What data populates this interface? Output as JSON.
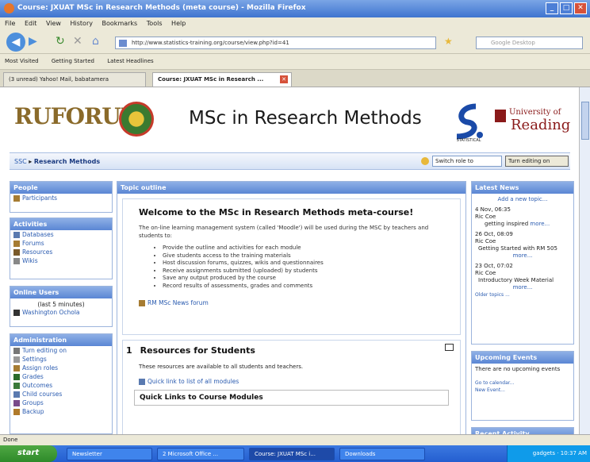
{
  "window": {
    "title": "Course: JXUAT MSc in Research Methods (meta course) - Mozilla Firefox"
  },
  "menu": [
    "File",
    "Edit",
    "View",
    "History",
    "Bookmarks",
    "Tools",
    "Help"
  ],
  "nav": {
    "url": "http://www.statistics-training.org/course/view.php?id=41",
    "search_placeholder": "Google Desktop"
  },
  "bookmarks": [
    "Most Visited",
    "Getting Started",
    "Latest Headlines"
  ],
  "tabs": [
    {
      "label": "(3 unread) Yahoo! Mail, babatamera"
    },
    {
      "label": "Course: JXUAT MSc in Research ..."
    }
  ],
  "header": {
    "ruforum": "RUFORUM",
    "title": "MSc in Research Methods",
    "university_line1": "University of",
    "university_line2": "Reading",
    "statistical": "STATISTICAL"
  },
  "breadcrumb": {
    "root": "SSC",
    "current": "Research Methods",
    "switch_label": "Switch role to",
    "edit_button": "Turn editing on"
  },
  "left": {
    "people": {
      "title": "People",
      "items": [
        "Participants"
      ]
    },
    "activities": {
      "title": "Activities",
      "items": [
        "Databases",
        "Forums",
        "Resources",
        "Wikis"
      ]
    },
    "online": {
      "title": "Online Users",
      "note": "(last 5 minutes)",
      "user": "Washington Ochola"
    },
    "admin": {
      "title": "Administration",
      "items": [
        "Turn editing on",
        "Settings",
        "Assign roles",
        "Grades",
        "Outcomes",
        "Child courses",
        "Groups",
        "Backup"
      ]
    }
  },
  "main": {
    "title": "Topic outline",
    "welcome": {
      "heading": "Welcome to the MSc in Research Methods meta-course!",
      "intro": "The on-line learning management system (called 'Moodle') will be used during the MSC by teachers and students to:",
      "bullets": [
        "Provide the outline and activities for each module",
        "Give students access to the training materials",
        "Host discussion forums, quizzes, wikis and questionnaires",
        "Receive assignments submitted (uploaded) by students",
        "Save any output produced by the course",
        "Record results of assessments, grades and comments"
      ],
      "forum": "RM MSc News forum"
    },
    "section1": {
      "number": "1",
      "heading": "Resources for Students",
      "text": "These resources are available to all students and teachers.",
      "link": "Quick link to list of all modules",
      "sub": "Quick Links to Course Modules"
    }
  },
  "right": {
    "news": {
      "title": "Latest News",
      "add": "Add a new topic...",
      "items": [
        {
          "date": "4 Nov, 06:35",
          "author": "Ric Coe",
          "text": "getting inspired",
          "more": "more..."
        },
        {
          "date": "26 Oct, 08:09",
          "author": "Ric Coe",
          "text": "Getting Started with RM 505",
          "more": "more..."
        },
        {
          "date": "23 Oct, 07:02",
          "author": "Ric Coe",
          "text": "Introductory Week Material",
          "more": "more..."
        }
      ],
      "older": "Older topics ..."
    },
    "events": {
      "title": "Upcoming Events",
      "text": "There are no upcoming events",
      "calendar": "Go to calendar...",
      "new_event": "New Event..."
    },
    "activity": {
      "title": "Recent Activity"
    }
  },
  "status": "Done",
  "taskbar": {
    "start": "start",
    "items": [
      "Newsletter",
      "2 Microsoft Office ...",
      "Course: JXUAT MSc i...",
      "Downloads"
    ],
    "tray_time": "10:37 AM",
    "tray_label": "gadgets"
  }
}
